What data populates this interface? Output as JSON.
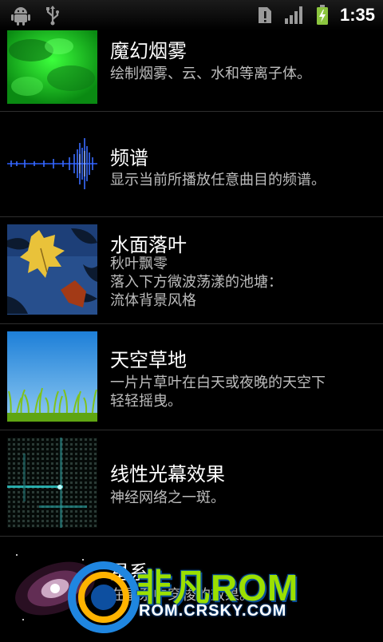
{
  "status_bar": {
    "time": "1:35",
    "icons": [
      "android-debug-icon",
      "usb-icon",
      "sim-alert-icon",
      "signal-icon",
      "battery-charging-icon"
    ]
  },
  "items": [
    {
      "title": "魔幻烟雾",
      "desc": "绘制烟雾、云、水和等离子体。",
      "thumb": "green-smoke-thumbnail"
    },
    {
      "title": "频谱",
      "desc": "显示当前所播放任意曲目的频谱。",
      "thumb": "spectrum-thumbnail"
    },
    {
      "title": "水面落叶",
      "desc": "秋叶飘零\n落入下方微波荡漾的池塘：\n流体背景风格",
      "thumb": "falling-leaves-thumbnail"
    },
    {
      "title": "天空草地",
      "desc": "一片片草叶在白天或夜晚的天空下\n轻轻摇曳。",
      "thumb": "sky-grass-thumbnail"
    },
    {
      "title": "线性光幕效果",
      "desc": "神经网络之一斑。",
      "thumb": "grid-lights-thumbnail"
    },
    {
      "title": "星系",
      "desc": "在星系中穿梭的效果。",
      "thumb": "galaxy-thumbnail"
    }
  ],
  "watermark": {
    "brand": "非凡ROM",
    "url": "ROM.CRSKY.COM"
  },
  "colors": {
    "background": "#000000",
    "subtitle": "#bdbdbd",
    "watermark_green": "#9be000",
    "watermark_blue": "#1f86e0"
  }
}
